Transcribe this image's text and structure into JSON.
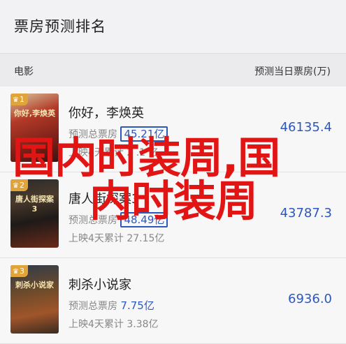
{
  "header": {
    "title": "票房预测排名"
  },
  "columns": {
    "left": "电影",
    "right": "预测当日票房(万)"
  },
  "movies": [
    {
      "badge": "1",
      "poster_title": "你好,李焕英",
      "name": "你好，李焕英",
      "pred_label": "预测总票房",
      "pred_value": "45.21亿",
      "total_text": "上映4天累计 2 .1 亿",
      "value": "46135.4"
    },
    {
      "badge": "2",
      "poster_title": "唐人街探案3",
      "name": "唐人街探案3",
      "pred_label": "预测总票房",
      "pred_value": "48.49亿",
      "total_text": "上映4天累计 27.15亿",
      "value": "43787.3"
    },
    {
      "badge": "3",
      "poster_title": "刺杀小说家",
      "name": "刺杀小说家",
      "pred_label": "预测总票房",
      "pred_value": "7.75亿",
      "total_text": "上映4天累计 3.38亿",
      "value": "6936.0"
    }
  ],
  "overlay": {
    "line1": "国内时装周,国",
    "line2": "内时装周"
  },
  "colors": {
    "accent": "#2d57b8",
    "overlay": "#e21515",
    "badge": "#e0a43a"
  }
}
